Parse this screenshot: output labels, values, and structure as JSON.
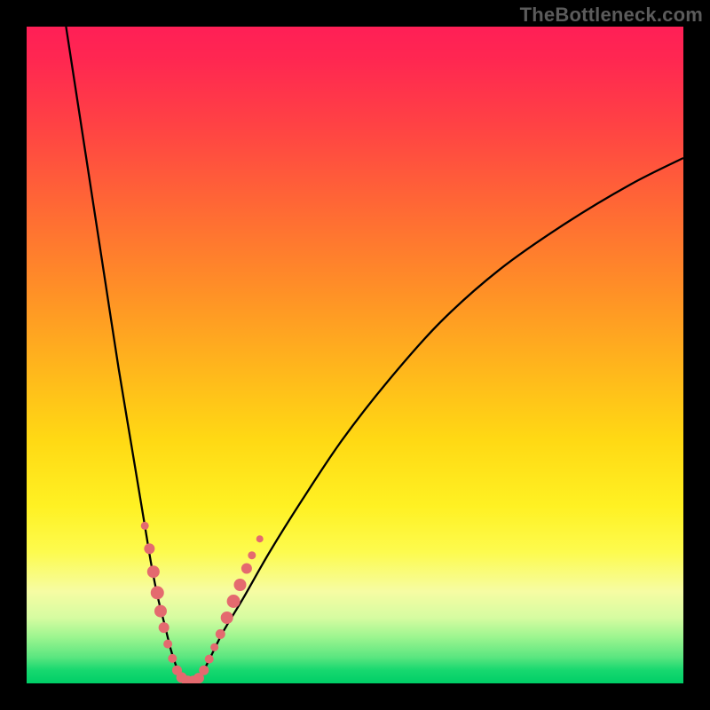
{
  "watermark": "TheBottleneck.com",
  "colors": {
    "frame": "#000000",
    "curve": "#000000",
    "marker": "#e46a6f",
    "gradient_top": "#ff1f56",
    "gradient_bottom": "#00ce67"
  },
  "chart_data": {
    "type": "line",
    "title": "",
    "xlabel": "",
    "ylabel": "",
    "xlim": [
      0,
      100
    ],
    "ylim": [
      0,
      100
    ],
    "grid": false,
    "legend": null,
    "series": [
      {
        "name": "left-curve",
        "x": [
          6,
          8,
          10,
          12,
          14,
          16,
          18,
          19,
          20,
          21,
          22,
          23,
          23.5,
          24
        ],
        "y": [
          100,
          87,
          74,
          61,
          48,
          36,
          24,
          18,
          13,
          9,
          5,
          2,
          1,
          0
        ]
      },
      {
        "name": "right-curve",
        "x": [
          26,
          27,
          28,
          30,
          33,
          37,
          42,
          48,
          55,
          63,
          72,
          82,
          92,
          100
        ],
        "y": [
          0,
          2,
          4,
          8,
          13,
          20,
          28,
          37,
          46,
          55,
          63,
          70,
          76,
          80
        ]
      }
    ],
    "markers": [
      {
        "series": "left-curve",
        "x": 18.0,
        "y": 24.0,
        "size": 4.5
      },
      {
        "series": "left-curve",
        "x": 18.7,
        "y": 20.5,
        "size": 6.0
      },
      {
        "series": "left-curve",
        "x": 19.3,
        "y": 17.0,
        "size": 7.0
      },
      {
        "series": "left-curve",
        "x": 19.9,
        "y": 13.8,
        "size": 7.5
      },
      {
        "series": "left-curve",
        "x": 20.4,
        "y": 11.0,
        "size": 7.0
      },
      {
        "series": "left-curve",
        "x": 20.9,
        "y": 8.5,
        "size": 6.0
      },
      {
        "series": "left-curve",
        "x": 21.5,
        "y": 6.0,
        "size": 5.0
      },
      {
        "series": "left-curve",
        "x": 22.2,
        "y": 3.8,
        "size": 5.0
      },
      {
        "series": "left-curve",
        "x": 22.9,
        "y": 2.0,
        "size": 5.5
      },
      {
        "series": "left-curve",
        "x": 23.6,
        "y": 0.9,
        "size": 6.0
      },
      {
        "series": "left-curve",
        "x": 24.5,
        "y": 0.3,
        "size": 6.5
      },
      {
        "series": "left-curve",
        "x": 25.4,
        "y": 0.3,
        "size": 6.5
      },
      {
        "series": "right-curve",
        "x": 26.2,
        "y": 0.8,
        "size": 6.0
      },
      {
        "series": "right-curve",
        "x": 27.0,
        "y": 2.0,
        "size": 5.5
      },
      {
        "series": "right-curve",
        "x": 27.8,
        "y": 3.7,
        "size": 5.0
      },
      {
        "series": "right-curve",
        "x": 28.6,
        "y": 5.5,
        "size": 4.5
      },
      {
        "series": "right-curve",
        "x": 29.5,
        "y": 7.5,
        "size": 5.5
      },
      {
        "series": "right-curve",
        "x": 30.5,
        "y": 10.0,
        "size": 7.0
      },
      {
        "series": "right-curve",
        "x": 31.5,
        "y": 12.5,
        "size": 7.5
      },
      {
        "series": "right-curve",
        "x": 32.5,
        "y": 15.0,
        "size": 7.0
      },
      {
        "series": "right-curve",
        "x": 33.5,
        "y": 17.5,
        "size": 6.0
      },
      {
        "series": "right-curve",
        "x": 34.3,
        "y": 19.5,
        "size": 4.5
      },
      {
        "series": "right-curve",
        "x": 35.5,
        "y": 22.0,
        "size": 4.0
      }
    ]
  }
}
